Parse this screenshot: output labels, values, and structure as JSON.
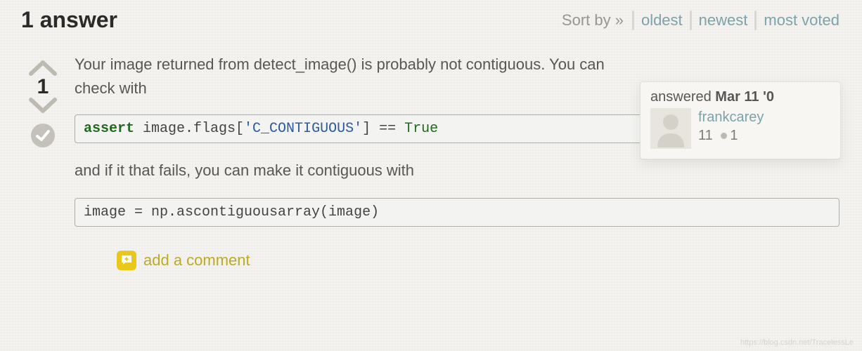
{
  "header": {
    "title": "1 answer",
    "sort_label": "Sort by »",
    "tabs": [
      "oldest",
      "newest",
      "most voted"
    ]
  },
  "vote": {
    "score": "1"
  },
  "answer": {
    "para1": "Your image returned from detect_image() is probably not contiguous. You can check with",
    "code1": {
      "kw": "assert",
      "mid": " image.flags[",
      "str": "'C_CONTIGUOUS'",
      "post": "] == ",
      "const": "True"
    },
    "para2": "and if it that fails, you can make it contiguous with",
    "code2": "image = np.ascontiguousarray(image)"
  },
  "usercard": {
    "prefix": "answered ",
    "date": "Mar 11 '0",
    "username": "frankcarey",
    "rep": "11",
    "badge_count": "1"
  },
  "add_comment": "add a comment",
  "watermark": "https://blog.csdn.net/TracelessLe"
}
